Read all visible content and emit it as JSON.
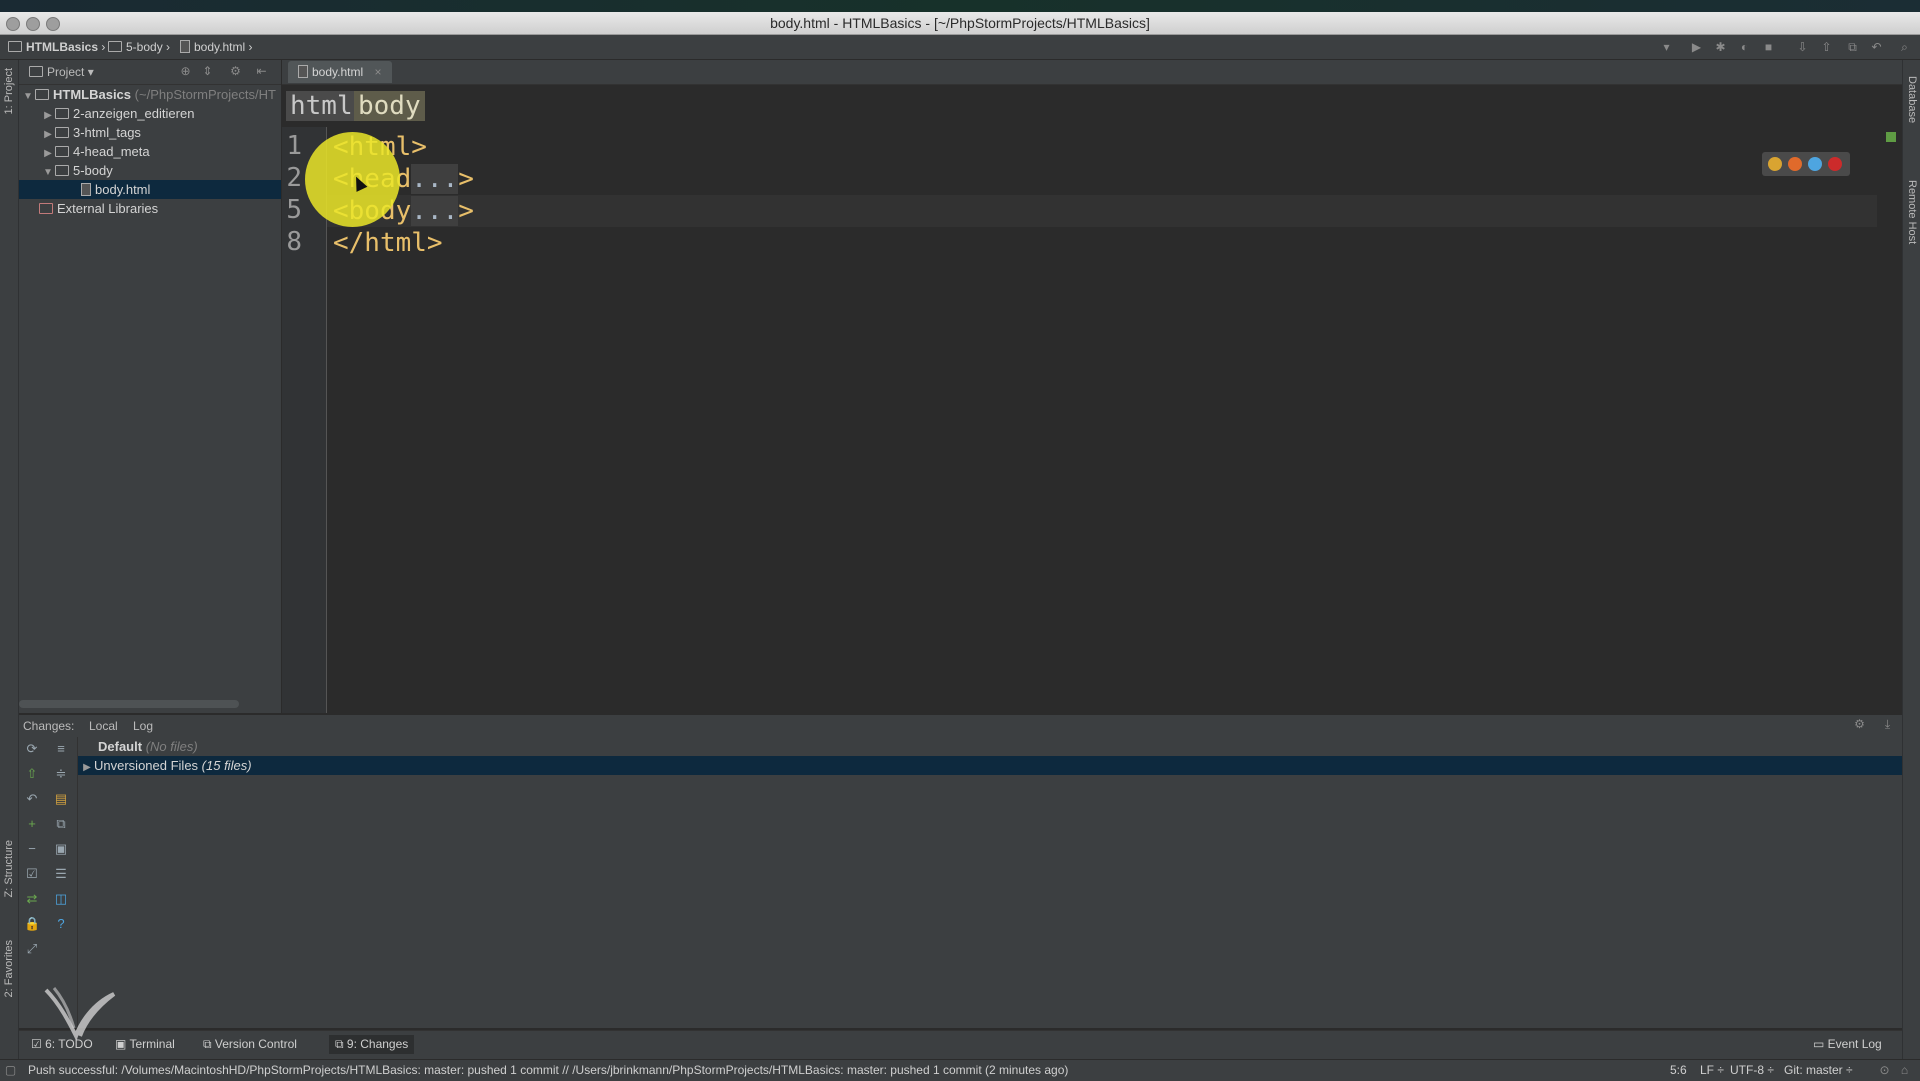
{
  "window": {
    "title": "body.html - HTMLBasics - [~/PhpStormProjects/HTMLBasics]"
  },
  "navbar": {
    "crumbs": [
      "HTMLBasics",
      "5-body",
      "body.html"
    ]
  },
  "left_strip": {
    "project": "1: Project",
    "structure": "Z: Structure",
    "favorites": "2: Favorites"
  },
  "right_strip": {
    "database": "Database",
    "remote": "Remote Host"
  },
  "project_panel": {
    "title": "Project",
    "tree": [
      {
        "label": "HTMLBasics",
        "suffix": "(~/PhpStormProjects/HT",
        "depth": 0,
        "expanded": true,
        "kind": "folder"
      },
      {
        "label": "2-anzeigen_editieren",
        "depth": 1,
        "expanded": false,
        "kind": "folder"
      },
      {
        "label": "3-html_tags",
        "depth": 1,
        "expanded": false,
        "kind": "folder"
      },
      {
        "label": "4-head_meta",
        "depth": 1,
        "expanded": false,
        "kind": "folder"
      },
      {
        "label": "5-body",
        "depth": 1,
        "expanded": true,
        "kind": "folder"
      },
      {
        "label": "body.html",
        "depth": 2,
        "kind": "file",
        "selected": true
      },
      {
        "label": "External Libraries",
        "depth": 0,
        "kind": "lib"
      }
    ]
  },
  "editor": {
    "tab_label": "body.html",
    "breadcrumbs": [
      "html",
      "body"
    ],
    "lines": [
      {
        "num": "1",
        "text": "<html>"
      },
      {
        "num": "2",
        "text": "<head",
        "fold": "...",
        "tail": ">"
      },
      {
        "num": "5",
        "text": "<body",
        "fold": "...",
        "tail": ">"
      },
      {
        "num": "8",
        "text": "</html>"
      }
    ]
  },
  "changes": {
    "label": "Changes:",
    "tabs": [
      "Local",
      "Log"
    ],
    "rows": [
      {
        "name": "Default",
        "detail": "(No files)"
      },
      {
        "name": "Unversioned Files",
        "detail": "(15 files)",
        "selected": true
      }
    ]
  },
  "bottom_tabs": {
    "todo": "6: TODO",
    "terminal": "Terminal",
    "vcs": "Version Control",
    "changes": "9: Changes",
    "eventlog": "Event Log"
  },
  "status": {
    "message": "Push successful: /Volumes/MacintoshHD/PhpStormProjects/HTMLBasics: master: pushed 1 commit // /Users/jbrinkmann/PhpStormProjects/HTMLBasics: master: pushed 1 commit (2 minutes ago)",
    "position": "5:6",
    "line_sep": "LF ÷",
    "encoding": "UTF-8 ÷",
    "git": "Git: master ÷"
  },
  "colors": {
    "accent_selection": "#0d293e",
    "tag": "#e8bf6a",
    "highlight": "#ebe628"
  }
}
